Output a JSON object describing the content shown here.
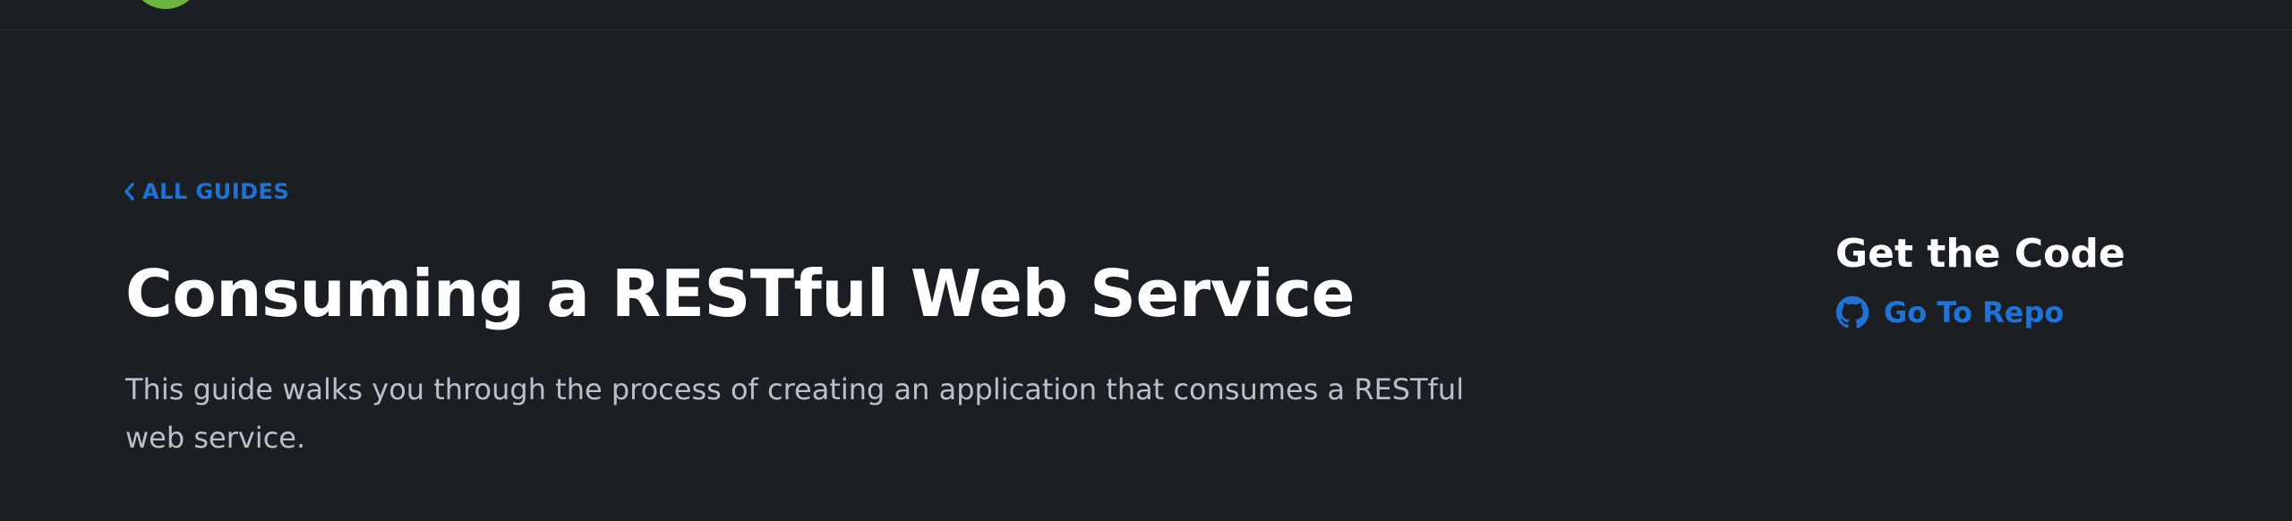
{
  "header": {
    "logo_icon": "spring-logo-icon"
  },
  "breadcrumb": {
    "back_label": "ALL GUIDES",
    "back_icon": "chevron-left-icon"
  },
  "guide": {
    "title": "Consuming a RESTful Web Service",
    "description": "This guide walks you through the process of creating an application that consumes a RESTful web service."
  },
  "sidebar": {
    "title": "Get the Code",
    "repo_label": "Go To Repo",
    "repo_icon": "github-icon"
  },
  "colors": {
    "background": "#1b1f24",
    "accent": "#1f73d6",
    "logo": "#6db33f",
    "text_primary": "#ffffff",
    "text_secondary": "#b9c0c7"
  }
}
